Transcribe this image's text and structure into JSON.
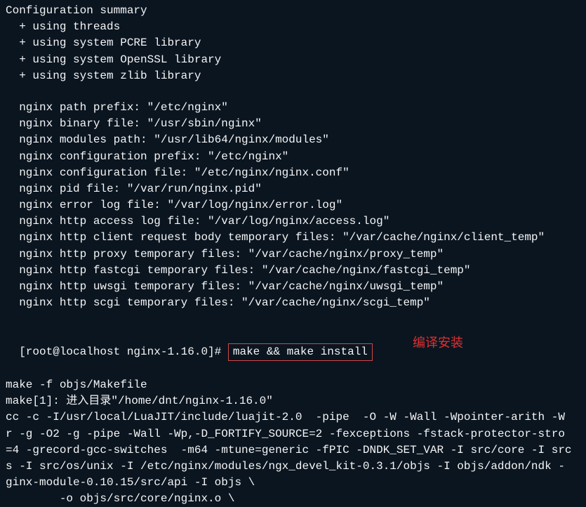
{
  "summary_header": "Configuration summary",
  "summary_items": [
    "  + using threads",
    "  + using system PCRE library",
    "  + using system OpenSSL library",
    "  + using system zlib library"
  ],
  "config_lines": [
    "  nginx path prefix: \"/etc/nginx\"",
    "  nginx binary file: \"/usr/sbin/nginx\"",
    "  nginx modules path: \"/usr/lib64/nginx/modules\"",
    "  nginx configuration prefix: \"/etc/nginx\"",
    "  nginx configuration file: \"/etc/nginx/nginx.conf\"",
    "  nginx pid file: \"/var/run/nginx.pid\"",
    "  nginx error log file: \"/var/log/nginx/error.log\"",
    "  nginx http access log file: \"/var/log/nginx/access.log\"",
    "  nginx http client request body temporary files: \"/var/cache/nginx/client_temp\"",
    "  nginx http proxy temporary files: \"/var/cache/nginx/proxy_temp\"",
    "  nginx http fastcgi temporary files: \"/var/cache/nginx/fastcgi_temp\"",
    "  nginx http uwsgi temporary files: \"/var/cache/nginx/uwsgi_temp\"",
    "  nginx http scgi temporary files: \"/var/cache/nginx/scgi_temp\""
  ],
  "prompt_prefix": "[root@localhost nginx-1.16.0]# ",
  "command": "make && make install",
  "annotation": "编译安装",
  "build_lines": [
    "make -f objs/Makefile",
    "make[1]: 进入目录\"/home/dnt/nginx-1.16.0\"",
    "cc -c -I/usr/local/LuaJIT/include/luajit-2.0  -pipe  -O -W -Wall -Wpointer-arith -W",
    "r -g -O2 -g -pipe -Wall -Wp,-D_FORTIFY_SOURCE=2 -fexceptions -fstack-protector-stro",
    "=4 -grecord-gcc-switches  -m64 -mtune=generic -fPIC -DNDK_SET_VAR -I src/core -I src",
    "s -I src/os/unix -I /etc/nginx/modules/ngx_devel_kit-0.3.1/objs -I objs/addon/ndk -",
    "ginx-module-0.10.15/src/api -I objs \\",
    "        -o objs/src/core/nginx.o \\"
  ]
}
